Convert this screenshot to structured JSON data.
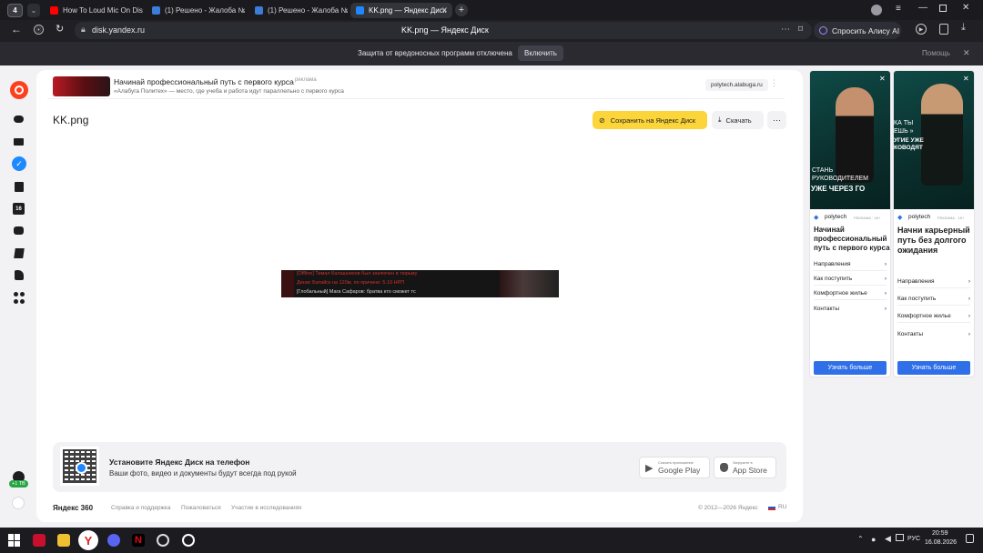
{
  "browser": {
    "tab_count": "4",
    "tabs": [
      {
        "title": "How To Loud Mic On Disc",
        "color": "#ff0000"
      },
      {
        "title": "(1) Решено - Жалоба №14",
        "color": "#3b7dd8"
      },
      {
        "title": "(1) Решено - Жалоба №14",
        "color": "#3b7dd8"
      },
      {
        "title": "KK.png — Яндекс Диск",
        "color": "#1e88ff"
      }
    ],
    "url": "disk.yandex.ru",
    "page_title": "KK.png — Яндекс Диск",
    "alice_label": "Спросить Алису AI"
  },
  "protection": {
    "message": "Защита от вредоносных программ отключена",
    "enable_label": "Включить",
    "help_label": "Помощь"
  },
  "ad_top": {
    "title": "Начинай профессиональный путь с первого курса",
    "tag": "реклама",
    "subtitle": "«Алабуга Политех» — место, где учеба и работа идут параллельно с первого курса",
    "domain": "polytech.alabuga.ru"
  },
  "file": {
    "name": "KK.png",
    "save_label": "Сохранить на Яндекс Диск",
    "download_label": "Скачать",
    "preview_lines": [
      "[Offline] Тимал Калашников был заключен в тюрьму",
      "Денис Батайск на 120м, по причине: 5.10 НРП",
      "[Глобальный] Мага Сафаров: братва кто сможет тс"
    ]
  },
  "promo": {
    "title": "Установите Яндекс Диск на телефон",
    "subtitle": "Ваши фото, видео и документы будут всегда под рукой",
    "google_small": "Скачать приложение",
    "google_label": "Google Play",
    "apple_small": "Загрузите в",
    "apple_label": "App Store"
  },
  "footer": {
    "brand": "Яндекс 360",
    "links": [
      "Справка и поддержка",
      "Пожаловаться",
      "Участие в исследованиях"
    ],
    "copyright": "© 2012—2026 Яндекс",
    "lang": "RU"
  },
  "ads_right": [
    {
      "overlay1": "СТАНЬ",
      "overlay2": "РУКОВОДИТЕЛЕМ",
      "overlay3": "УЖЕ ЧЕРЕЗ ГО",
      "brand": "polytech",
      "tag": "РЕКЛАМА · 16+",
      "headline": "Начинай профессиональный путь с первого курса",
      "menu": [
        "Направления",
        "Как поступить",
        "Комфортное жилье",
        "Контакты"
      ],
      "cta": "Узнать больше"
    },
    {
      "overlay1": "КА ТЫ",
      "overlay2": "ЕШЬ »",
      "overlay3": "УГИЕ УЖЕ КОВОДЯТ",
      "brand": "polytech",
      "tag": "РЕКЛАМА · 16+",
      "headline": "Начни карьерный путь без долгого ожидания",
      "menu": [
        "Направления",
        "Как поступить",
        "Комфортное жилье",
        "Контакты"
      ],
      "cta": "Узнать больше"
    }
  ],
  "sidebar": {
    "badge": "+1 TB"
  },
  "taskbar": {
    "lang": "РУС",
    "time": "20:59",
    "date": "16.08.2026"
  }
}
